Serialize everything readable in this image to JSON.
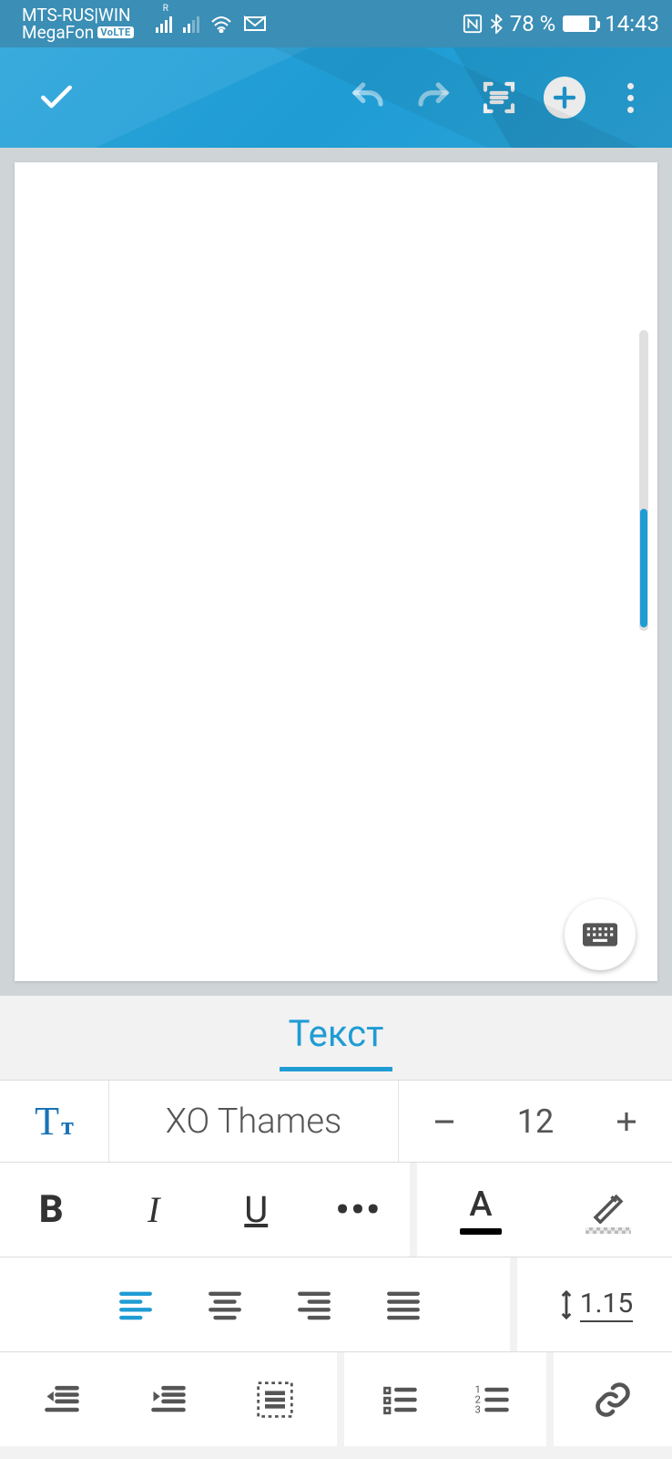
{
  "status": {
    "carrier1": "MTS-RUS|WIN",
    "carrier2": "MegaFon",
    "volte": "VoLTE",
    "battery_pct": "78 %",
    "time": "14:43"
  },
  "panel": {
    "tab_label": "Текст",
    "font_name": "XO Thames",
    "font_size": "12",
    "line_spacing": "1.15"
  }
}
